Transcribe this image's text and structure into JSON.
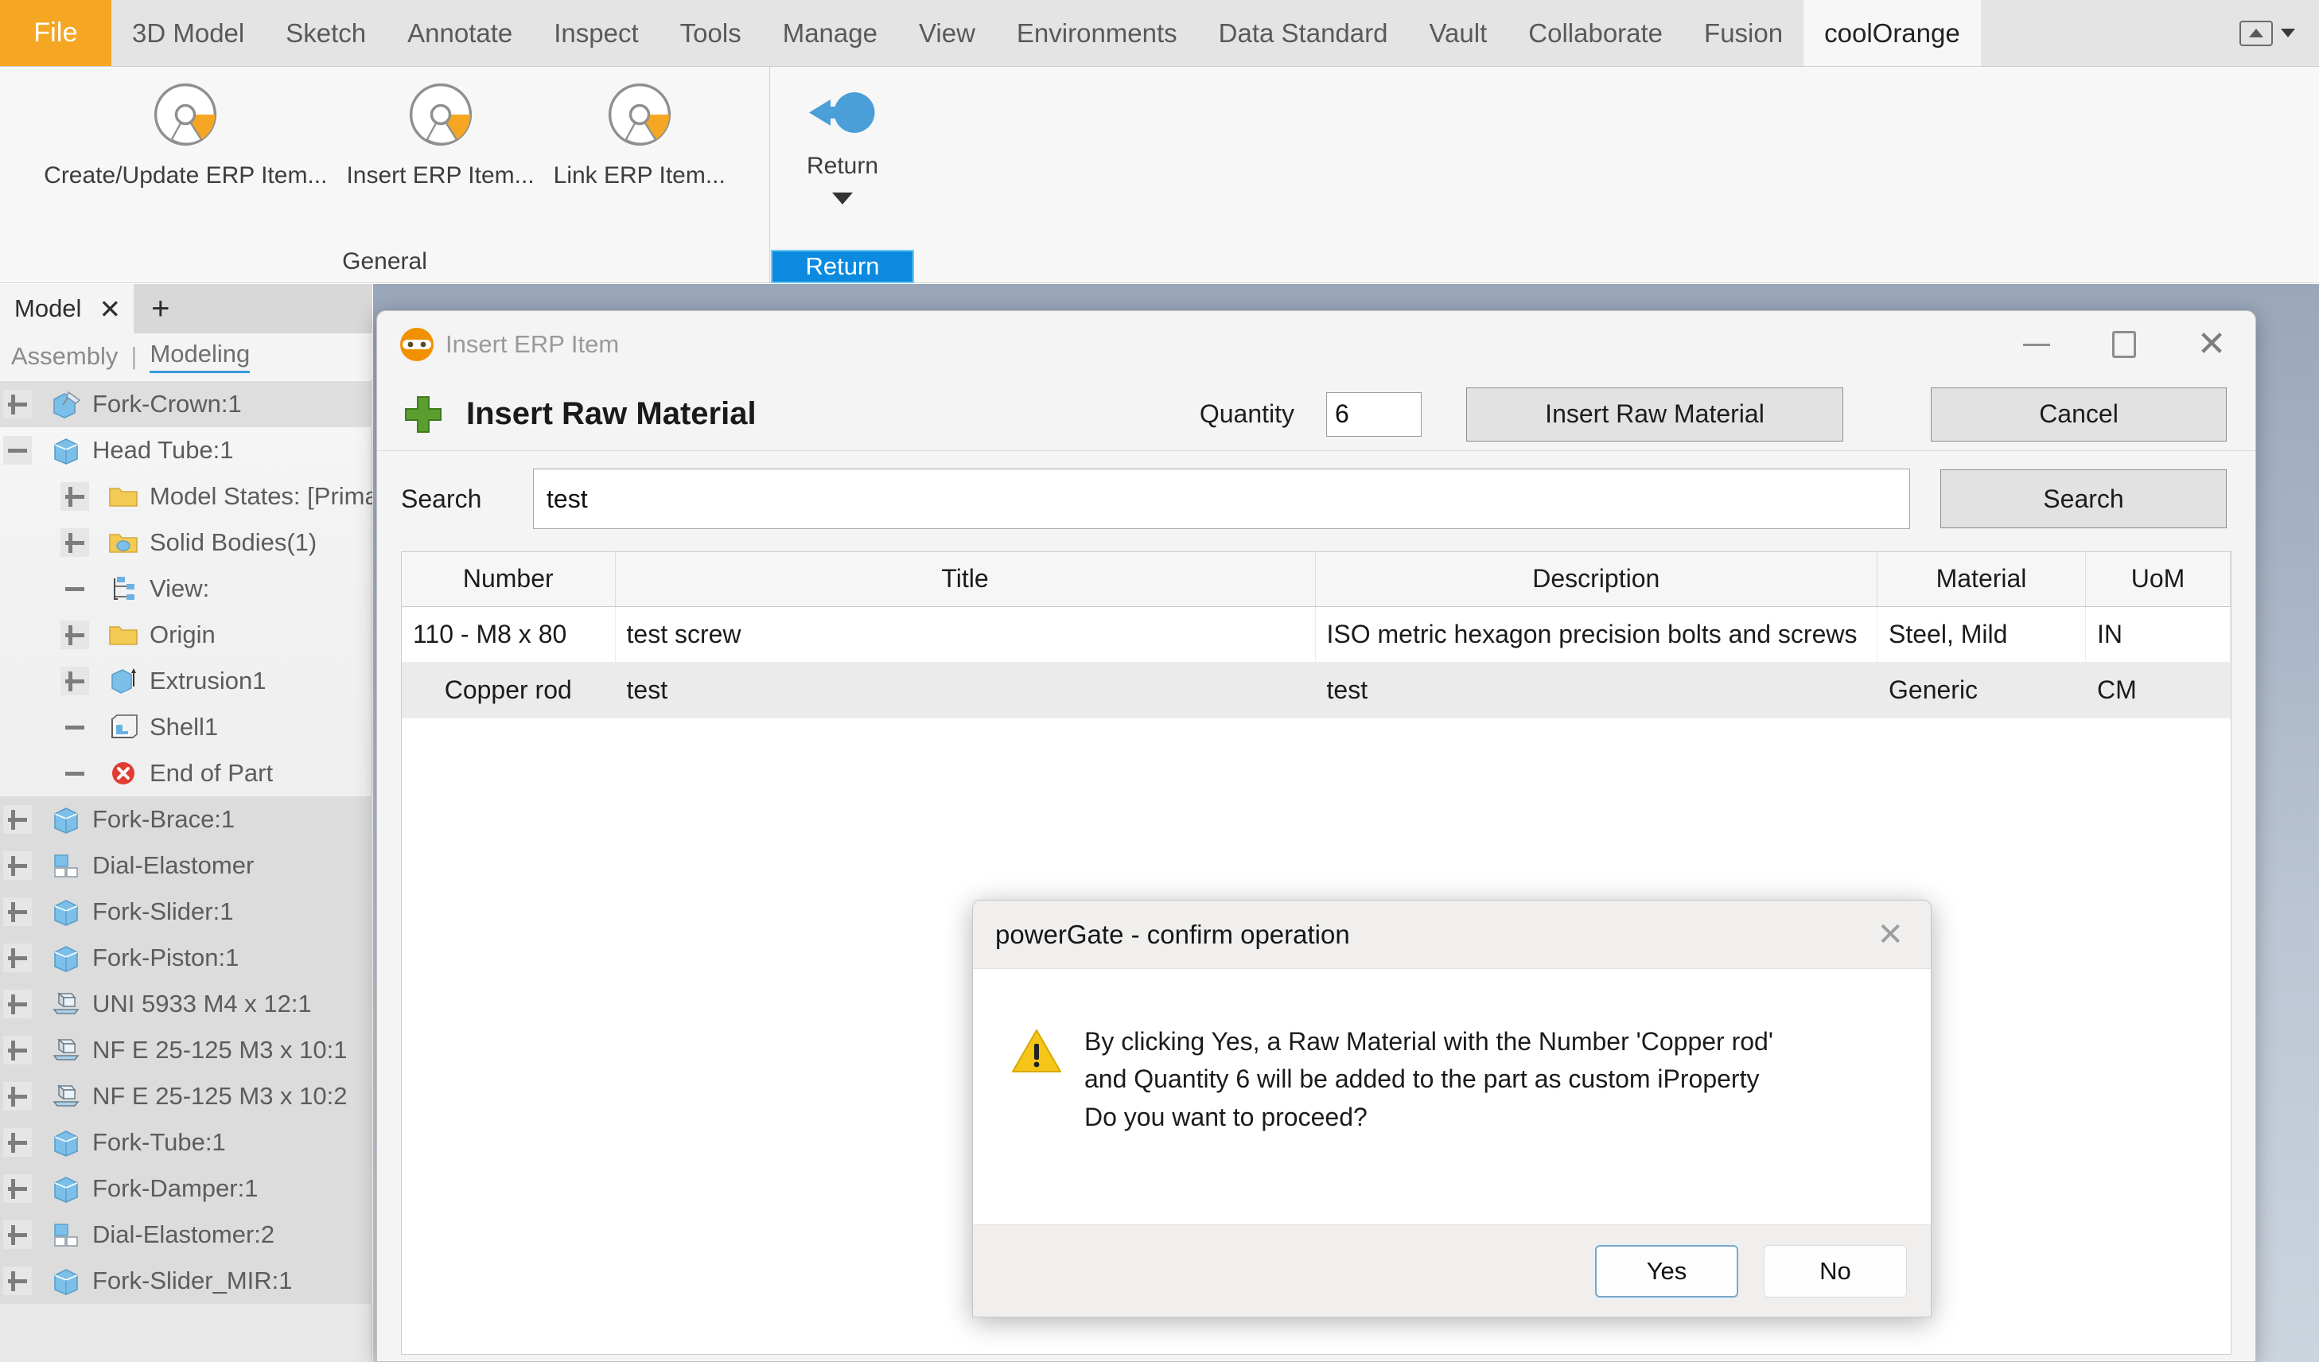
{
  "ribbon": {
    "tabs": [
      {
        "label": "File",
        "active": false,
        "file": true
      },
      {
        "label": "3D Model",
        "active": false
      },
      {
        "label": "Sketch",
        "active": false
      },
      {
        "label": "Annotate",
        "active": false
      },
      {
        "label": "Inspect",
        "active": false
      },
      {
        "label": "Tools",
        "active": false
      },
      {
        "label": "Manage",
        "active": false
      },
      {
        "label": "View",
        "active": false
      },
      {
        "label": "Environments",
        "active": false
      },
      {
        "label": "Data Standard",
        "active": false
      },
      {
        "label": "Vault",
        "active": false
      },
      {
        "label": "Collaborate",
        "active": false
      },
      {
        "label": "Fusion",
        "active": false
      },
      {
        "label": "coolOrange",
        "active": true
      }
    ],
    "groups": {
      "general": {
        "title": "General",
        "buttons": [
          {
            "label": "Create/Update ERP Item...",
            "icon": "erp-item-icon"
          },
          {
            "label": "Insert ERP Item...",
            "icon": "erp-item-icon"
          },
          {
            "label": "Link ERP Item...",
            "icon": "erp-item-icon"
          }
        ]
      },
      "return": {
        "label": "Return",
        "pill_label": "Return",
        "icon": "return-arrow-icon"
      }
    }
  },
  "browser": {
    "tab_label": "Model",
    "close_label": "✕",
    "add_label": "+",
    "subtabs": {
      "assembly": "Assembly",
      "separator": "|",
      "modeling": "Modeling"
    },
    "items": [
      {
        "label": "Fork-Crown:1",
        "indent": 1,
        "expander": "plus",
        "icon": "pinned-part-icon",
        "selected": true
      },
      {
        "label": "Head Tube:1",
        "indent": 1,
        "expander": "minus",
        "icon": "part-icon",
        "selected": false
      },
      {
        "label": "Model States: [Primary",
        "indent": 2,
        "expander": "plus",
        "icon": "folder-icon",
        "selected": false
      },
      {
        "label": "Solid Bodies(1)",
        "indent": 2,
        "expander": "plus",
        "icon": "folder-solid-icon",
        "selected": false
      },
      {
        "label": "View:",
        "indent": 2,
        "expander": "none",
        "icon": "view-icon",
        "selected": false
      },
      {
        "label": "Origin",
        "indent": 2,
        "expander": "plus",
        "icon": "folder-icon",
        "selected": false
      },
      {
        "label": "Extrusion1",
        "indent": 2,
        "expander": "plus",
        "icon": "extrusion-icon",
        "selected": false
      },
      {
        "label": "Shell1",
        "indent": 2,
        "expander": "none",
        "icon": "shell-icon",
        "selected": false
      },
      {
        "label": "End of Part",
        "indent": 2,
        "expander": "none",
        "icon": "end-of-part-icon",
        "selected": false
      },
      {
        "label": "Fork-Brace:1",
        "indent": 1,
        "expander": "plus",
        "icon": "part-icon",
        "selected": true
      },
      {
        "label": "Dial-Elastomer",
        "indent": 1,
        "expander": "plus",
        "icon": "assembly-icon",
        "selected": true
      },
      {
        "label": "Fork-Slider:1",
        "indent": 1,
        "expander": "plus",
        "icon": "part-icon",
        "selected": true
      },
      {
        "label": "Fork-Piston:1",
        "indent": 1,
        "expander": "plus",
        "icon": "part-icon",
        "selected": true
      },
      {
        "label": "UNI 5933 M4 x 12:1",
        "indent": 1,
        "expander": "plus",
        "icon": "fastener-icon",
        "selected": true
      },
      {
        "label": "NF E 25-125 M3 x 10:1",
        "indent": 1,
        "expander": "plus",
        "icon": "fastener-icon",
        "selected": true
      },
      {
        "label": "NF E 25-125 M3 x 10:2",
        "indent": 1,
        "expander": "plus",
        "icon": "fastener-icon",
        "selected": true
      },
      {
        "label": "Fork-Tube:1",
        "indent": 1,
        "expander": "plus",
        "icon": "part-icon",
        "selected": true
      },
      {
        "label": "Fork-Damper:1",
        "indent": 1,
        "expander": "plus",
        "icon": "part-icon",
        "selected": true
      },
      {
        "label": "Dial-Elastomer:2",
        "indent": 1,
        "expander": "plus",
        "icon": "assembly-icon",
        "selected": true
      },
      {
        "label": "Fork-Slider_MIR:1",
        "indent": 1,
        "expander": "plus",
        "icon": "part-icon",
        "selected": true
      }
    ]
  },
  "erp_dialog": {
    "window_title": "Insert ERP Item",
    "logo": "coolorange-ninja-icon",
    "heading": "Insert Raw Material",
    "plus_icon": "plus-icon",
    "quantity_label": "Quantity",
    "quantity_value": "6",
    "insert_button": "Insert Raw Material",
    "cancel_button": "Cancel",
    "minimize": "minimize-icon",
    "maximize": "maximize-icon",
    "close": "close-icon",
    "search": {
      "label": "Search",
      "value": "test",
      "button": "Search"
    },
    "table": {
      "columns": [
        "Number",
        "Title",
        "Description",
        "Material",
        "UoM"
      ],
      "rows": [
        {
          "number": "110 - M8 x 80",
          "title": "test screw",
          "description": "ISO metric hexagon precision bolts and screws",
          "material": "Steel, Mild",
          "uom": "IN",
          "selected": false
        },
        {
          "number": "Copper rod",
          "title": "test",
          "description": "test",
          "material": "Generic",
          "uom": "CM",
          "selected": true
        }
      ]
    }
  },
  "confirm_dialog": {
    "title": "powerGate - confirm operation",
    "close": "close-icon",
    "warning_icon": "warning-icon",
    "message_line1": "By clicking Yes, a Raw Material with the Number 'Copper rod'",
    "message_line2": "and Quantity 6 will be added to the part as custom iProperty",
    "message_line3": "Do you want to proceed?",
    "yes_button": "Yes",
    "no_button": "No"
  },
  "colors": {
    "file_tab_orange": "#f5a623",
    "accent_blue": "#0b8ae0",
    "coolorange": "#f29100",
    "warning_yellow": "#f5c518",
    "plus_green": "#5a9e2f"
  }
}
